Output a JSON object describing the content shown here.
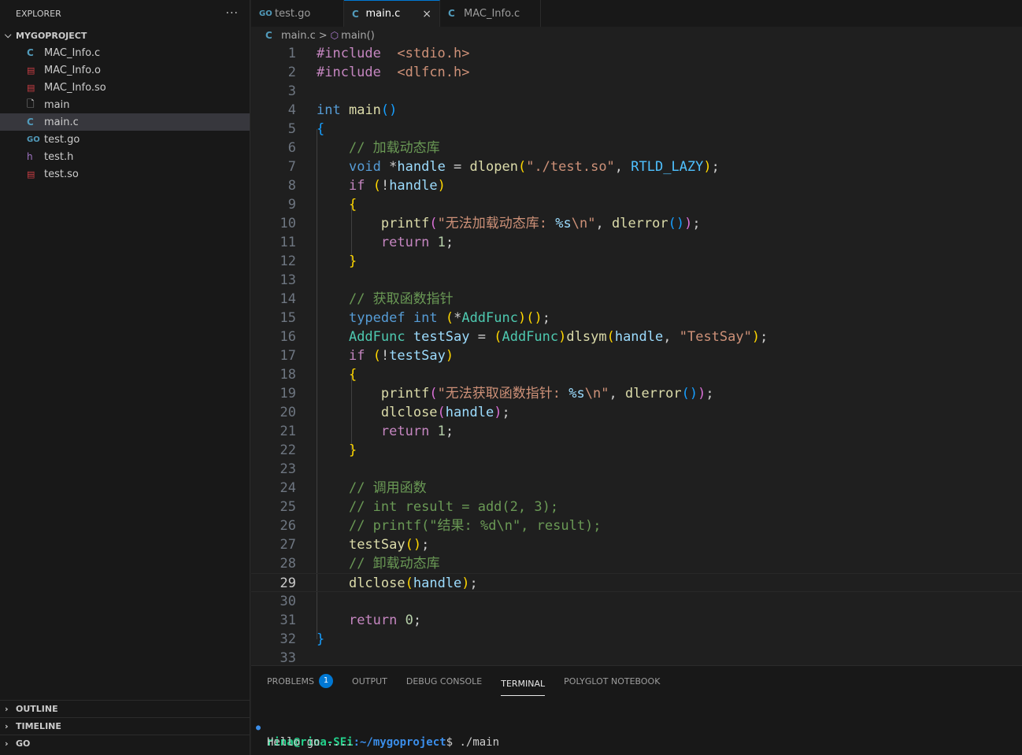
{
  "explorer": {
    "title": "EXPLORER",
    "more": "···",
    "project": "MYGOPROJECT",
    "files": [
      {
        "name": "MAC_Info.c",
        "icon": "C",
        "kind": "c-file-icon"
      },
      {
        "name": "MAC_Info.o",
        "icon": "▤",
        "kind": "binary-file-icon"
      },
      {
        "name": "MAC_Info.so",
        "icon": "▤",
        "kind": "binary-file-icon"
      },
      {
        "name": "main",
        "icon": "🗋",
        "kind": "file-icon"
      },
      {
        "name": "main.c",
        "icon": "C",
        "kind": "c-file-icon"
      },
      {
        "name": "test.go",
        "icon": "GO",
        "kind": "go-file-icon"
      },
      {
        "name": "test.h",
        "icon": "h",
        "kind": "header-file-icon"
      },
      {
        "name": "test.so",
        "icon": "▤",
        "kind": "binary-file-icon"
      }
    ],
    "sections": [
      "OUTLINE",
      "TIMELINE",
      "GO"
    ]
  },
  "tabs": [
    {
      "label": "test.go",
      "icon": "GO"
    },
    {
      "label": "main.c",
      "icon": "C",
      "close": "×"
    },
    {
      "label": "MAC_Info.c",
      "icon": "C"
    }
  ],
  "breadcrumb": {
    "file": "main.c",
    "sep": ">",
    "symbol": "main()"
  },
  "editor": {
    "current_line": 29,
    "line_numbers": [
      "1",
      "2",
      "3",
      "4",
      "5",
      "6",
      "7",
      "8",
      "9",
      "10",
      "11",
      "12",
      "13",
      "14",
      "15",
      "16",
      "17",
      "18",
      "19",
      "20",
      "21",
      "22",
      "23",
      "24",
      "25",
      "26",
      "27",
      "28",
      "29",
      "30",
      "31",
      "32",
      "33"
    ],
    "lines": [
      [
        [
          "pp",
          "#include"
        ],
        [
          "",
          "  "
        ],
        [
          "str",
          "<stdio.h>"
        ]
      ],
      [
        [
          "pp",
          "#include"
        ],
        [
          "",
          "  "
        ],
        [
          "str",
          "<dlfcn.h>"
        ]
      ],
      [],
      [
        [
          "kw",
          "int"
        ],
        [
          "",
          " "
        ],
        [
          "fn",
          "main"
        ],
        [
          "b3",
          "()"
        ]
      ],
      [
        [
          "b3",
          "{"
        ]
      ],
      [
        [
          "",
          "    "
        ],
        [
          "cmt",
          "// 加载动态库"
        ]
      ],
      [
        [
          "",
          "    "
        ],
        [
          "kw",
          "void"
        ],
        [
          "",
          " *"
        ],
        [
          "var",
          "handle"
        ],
        [
          "",
          " = "
        ],
        [
          "fn",
          "dlopen"
        ],
        [
          "b1",
          "("
        ],
        [
          "str",
          "\"./test.so\""
        ],
        [
          "",
          ", "
        ],
        [
          "const",
          "RTLD_LAZY"
        ],
        [
          "b1",
          ")"
        ],
        [
          "",
          ";"
        ]
      ],
      [
        [
          "",
          "    "
        ],
        [
          "ctl",
          "if"
        ],
        [
          "",
          " "
        ],
        [
          "b1",
          "("
        ],
        [
          "",
          "!"
        ],
        [
          "var",
          "handle"
        ],
        [
          "b1",
          ")"
        ]
      ],
      [
        [
          "",
          "    "
        ],
        [
          "b1",
          "{"
        ]
      ],
      [
        [
          "",
          "        "
        ],
        [
          "fn",
          "printf"
        ],
        [
          "b2",
          "("
        ],
        [
          "str",
          "\"无法加载动态库: "
        ],
        [
          "var",
          "%s"
        ],
        [
          "str",
          "\\n\""
        ],
        [
          "",
          ", "
        ],
        [
          "fn",
          "dlerror"
        ],
        [
          "b3",
          "()"
        ],
        [
          "b2",
          ")"
        ],
        [
          "",
          ";"
        ]
      ],
      [
        [
          "",
          "        "
        ],
        [
          "ctl",
          "return"
        ],
        [
          "",
          " "
        ],
        [
          "num",
          "1"
        ],
        [
          "",
          ";"
        ]
      ],
      [
        [
          "",
          "    "
        ],
        [
          "b1",
          "}"
        ]
      ],
      [],
      [
        [
          "",
          "    "
        ],
        [
          "cmt",
          "// 获取函数指针"
        ]
      ],
      [
        [
          "",
          "    "
        ],
        [
          "kw",
          "typedef"
        ],
        [
          "",
          " "
        ],
        [
          "kw",
          "int"
        ],
        [
          "",
          " "
        ],
        [
          "b1",
          "("
        ],
        [
          "",
          "*"
        ],
        [
          "type",
          "AddFunc"
        ],
        [
          "b1",
          ")"
        ],
        [
          "b1",
          "()"
        ],
        [
          "",
          ";"
        ]
      ],
      [
        [
          "",
          "    "
        ],
        [
          "type",
          "AddFunc"
        ],
        [
          "",
          " "
        ],
        [
          "var",
          "testSay"
        ],
        [
          "",
          " = "
        ],
        [
          "b1",
          "("
        ],
        [
          "type",
          "AddFunc"
        ],
        [
          "b1",
          ")"
        ],
        [
          "fn",
          "dlsym"
        ],
        [
          "b1",
          "("
        ],
        [
          "var",
          "handle"
        ],
        [
          "",
          ", "
        ],
        [
          "str",
          "\"TestSay\""
        ],
        [
          "b1",
          ")"
        ],
        [
          "",
          ";"
        ]
      ],
      [
        [
          "",
          "    "
        ],
        [
          "ctl",
          "if"
        ],
        [
          "",
          " "
        ],
        [
          "b1",
          "("
        ],
        [
          "",
          "!"
        ],
        [
          "var",
          "testSay"
        ],
        [
          "b1",
          ")"
        ]
      ],
      [
        [
          "",
          "    "
        ],
        [
          "b1",
          "{"
        ]
      ],
      [
        [
          "",
          "        "
        ],
        [
          "fn",
          "printf"
        ],
        [
          "b2",
          "("
        ],
        [
          "str",
          "\"无法获取函数指针: "
        ],
        [
          "var",
          "%s"
        ],
        [
          "str",
          "\\n\""
        ],
        [
          "",
          ", "
        ],
        [
          "fn",
          "dlerror"
        ],
        [
          "b3",
          "()"
        ],
        [
          "b2",
          ")"
        ],
        [
          "",
          ";"
        ]
      ],
      [
        [
          "",
          "        "
        ],
        [
          "fn",
          "dlclose"
        ],
        [
          "b2",
          "("
        ],
        [
          "var",
          "handle"
        ],
        [
          "b2",
          ")"
        ],
        [
          "",
          ";"
        ]
      ],
      [
        [
          "",
          "        "
        ],
        [
          "ctl",
          "return"
        ],
        [
          "",
          " "
        ],
        [
          "num",
          "1"
        ],
        [
          "",
          ";"
        ]
      ],
      [
        [
          "",
          "    "
        ],
        [
          "b1",
          "}"
        ]
      ],
      [],
      [
        [
          "",
          "    "
        ],
        [
          "cmt",
          "// 调用函数"
        ]
      ],
      [
        [
          "",
          "    "
        ],
        [
          "cmt",
          "// int result = add(2, 3);"
        ]
      ],
      [
        [
          "",
          "    "
        ],
        [
          "cmt",
          "// printf(\"结果: %d\\n\", result);"
        ]
      ],
      [
        [
          "",
          "    "
        ],
        [
          "fn",
          "testSay"
        ],
        [
          "b1",
          "()"
        ],
        [
          "",
          ";"
        ]
      ],
      [
        [
          "",
          "    "
        ],
        [
          "cmt",
          "// 卸载动态库"
        ]
      ],
      [
        [
          "",
          "    "
        ],
        [
          "fn",
          "dlclose"
        ],
        [
          "b1",
          "("
        ],
        [
          "var",
          "handle"
        ],
        [
          "b1",
          ")"
        ],
        [
          "",
          ";"
        ]
      ],
      [],
      [
        [
          "",
          "    "
        ],
        [
          "ctl",
          "return"
        ],
        [
          "",
          " "
        ],
        [
          "num",
          "0"
        ],
        [
          "",
          ";"
        ]
      ],
      [
        [
          "b3",
          "}"
        ]
      ],
      []
    ]
  },
  "panel": {
    "tabs": [
      "PROBLEMS",
      "OUTPUT",
      "DEBUG CONSOLE",
      "TERMINAL",
      "POLYGLOT NOTEBOOK"
    ],
    "problems_count": "1",
    "active_tab": "TERMINAL",
    "terminal": {
      "user_host": "rina@rina-SEi",
      "path": ":~/mygoproject",
      "prompt_end": "$",
      "command": " ./main",
      "output": "Hello go ...."
    }
  },
  "colors": {
    "accent": "#0078d4",
    "terminal_user": "#23d18b",
    "terminal_path": "#3b8eea"
  }
}
